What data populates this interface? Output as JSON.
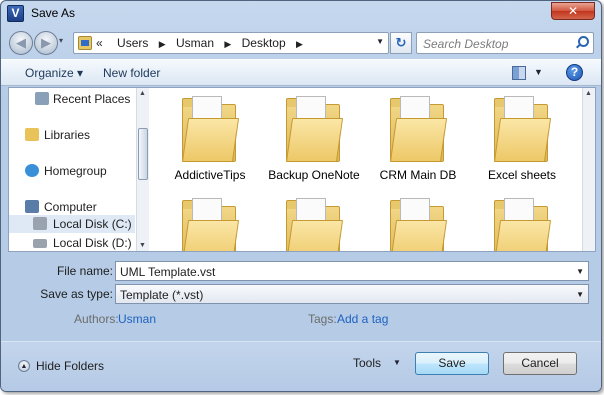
{
  "window": {
    "title": "Save As",
    "app_icon_letter": "V",
    "close_glyph": "✕"
  },
  "nav": {
    "back_glyph": "◀",
    "forward_glyph": "▶",
    "recent_glyph": "▾",
    "breadcrumb_prefix": "«",
    "breadcrumb": [
      "Users",
      "Usman",
      "Desktop"
    ],
    "separator_glyph": "▶",
    "address_dropdown_glyph": "▼",
    "refresh_glyph": "↻",
    "search_placeholder": "Search Desktop",
    "search_icon": "search-icon"
  },
  "toolbar": {
    "organize_label": "Organize ▾",
    "new_folder_label": "New folder",
    "views_dropdown_glyph": "▼",
    "help_glyph": "?"
  },
  "navpane": {
    "items": [
      {
        "label": "Recent Places",
        "icon": "recent-places-icon",
        "color": "#8aa0b8"
      },
      {
        "label": "Libraries",
        "icon": "libraries-icon",
        "color": "#e8c35a"
      },
      {
        "label": "Homegroup",
        "icon": "homegroup-icon",
        "color": "#3a8fd9"
      },
      {
        "label": "Computer",
        "icon": "computer-icon",
        "color": "#5a7ca8"
      },
      {
        "label": "Local Disk (C:)",
        "icon": "local-disk-c-icon",
        "color": "#9aa3ad"
      },
      {
        "label": "Local Disk (D:)",
        "icon": "local-disk-d-icon",
        "color": "#9aa3ad"
      }
    ],
    "scroll_up_glyph": "▲",
    "scroll_down_glyph": "▼"
  },
  "folders": [
    {
      "name": "AddictiveTips"
    },
    {
      "name": "Backup OneNote"
    },
    {
      "name": "CRM Main DB"
    },
    {
      "name": "Excel sheets"
    },
    {
      "name": ""
    },
    {
      "name": ""
    },
    {
      "name": ""
    },
    {
      "name": ""
    }
  ],
  "form": {
    "file_name_label": "File name:",
    "file_name_value": "UML Template.vst",
    "save_as_type_label": "Save as type:",
    "save_as_type_value": "Template (*.vst)",
    "dropdown_glyph": "▼",
    "authors_label": "Authors:",
    "authors_value": "Usman",
    "tags_label": "Tags:",
    "tags_value": "Add a tag"
  },
  "footer": {
    "hide_folders_glyph": "▲",
    "hide_folders_label": "Hide Folders",
    "tools_label": "Tools",
    "tools_dropdown_glyph": "▼",
    "save_label": "Save",
    "cancel_label": "Cancel"
  },
  "colors": {
    "accent": "#1f62bf",
    "folder": "#edc867",
    "window_frame": "#bcd1ea"
  }
}
